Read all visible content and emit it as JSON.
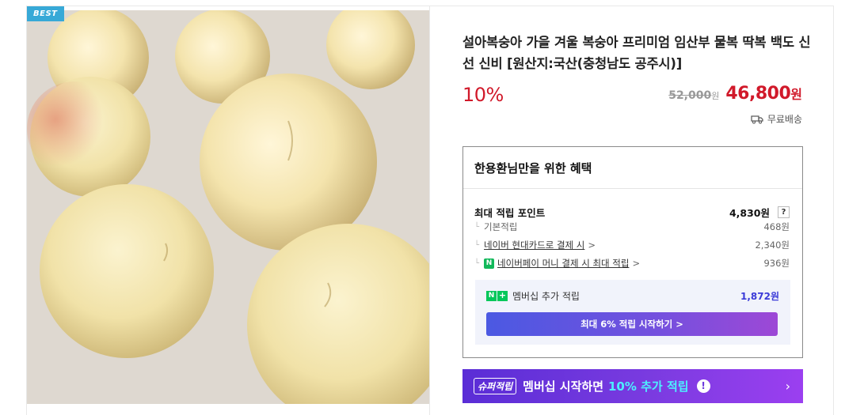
{
  "product": {
    "badge": "BEST",
    "title": "설아복숭아 가을 겨울 복숭아 프리미엄 임산부 물복 딱복 백도 신선 신비 [원산지:국산(충청남도 공주시)]",
    "discount": "10%",
    "original_price": "52,000",
    "original_won": "원",
    "sale_price": "46,800",
    "sale_won": "원",
    "shipping": "무료배송",
    "image_alt": "peaches photo"
  },
  "benefits": {
    "title": "한용환님만을 위한 혜택",
    "max_points_label": "최대 적립 포인트",
    "max_points_value": "4,830원",
    "help_label": "?",
    "items": [
      {
        "label": "기본적립",
        "value": "468원"
      },
      {
        "label": "네이버 현대카드로 결제 시",
        "value": "2,340원"
      },
      {
        "label": "네이버페이 머니 결제 시 최대 적립",
        "value": "936원"
      }
    ],
    "chevron": ">",
    "npay_badge": "N",
    "membership": {
      "badge_n": "N",
      "badge_plus": "+",
      "label": "멤버십 추가 적립",
      "value": "1,872원",
      "button": "최대 6% 적립 시작하기 >"
    }
  },
  "super_banner": {
    "tag": "슈퍼적립",
    "text": "멤버십 시작하면",
    "accent": "10% 추가 적립",
    "alert": "!",
    "chevron": "›"
  },
  "colors": {
    "accent_red": "#d1192a",
    "badge_blue": "#37a9d7",
    "naver_green": "#03c75a",
    "banner_purple": "#6a35dc"
  }
}
